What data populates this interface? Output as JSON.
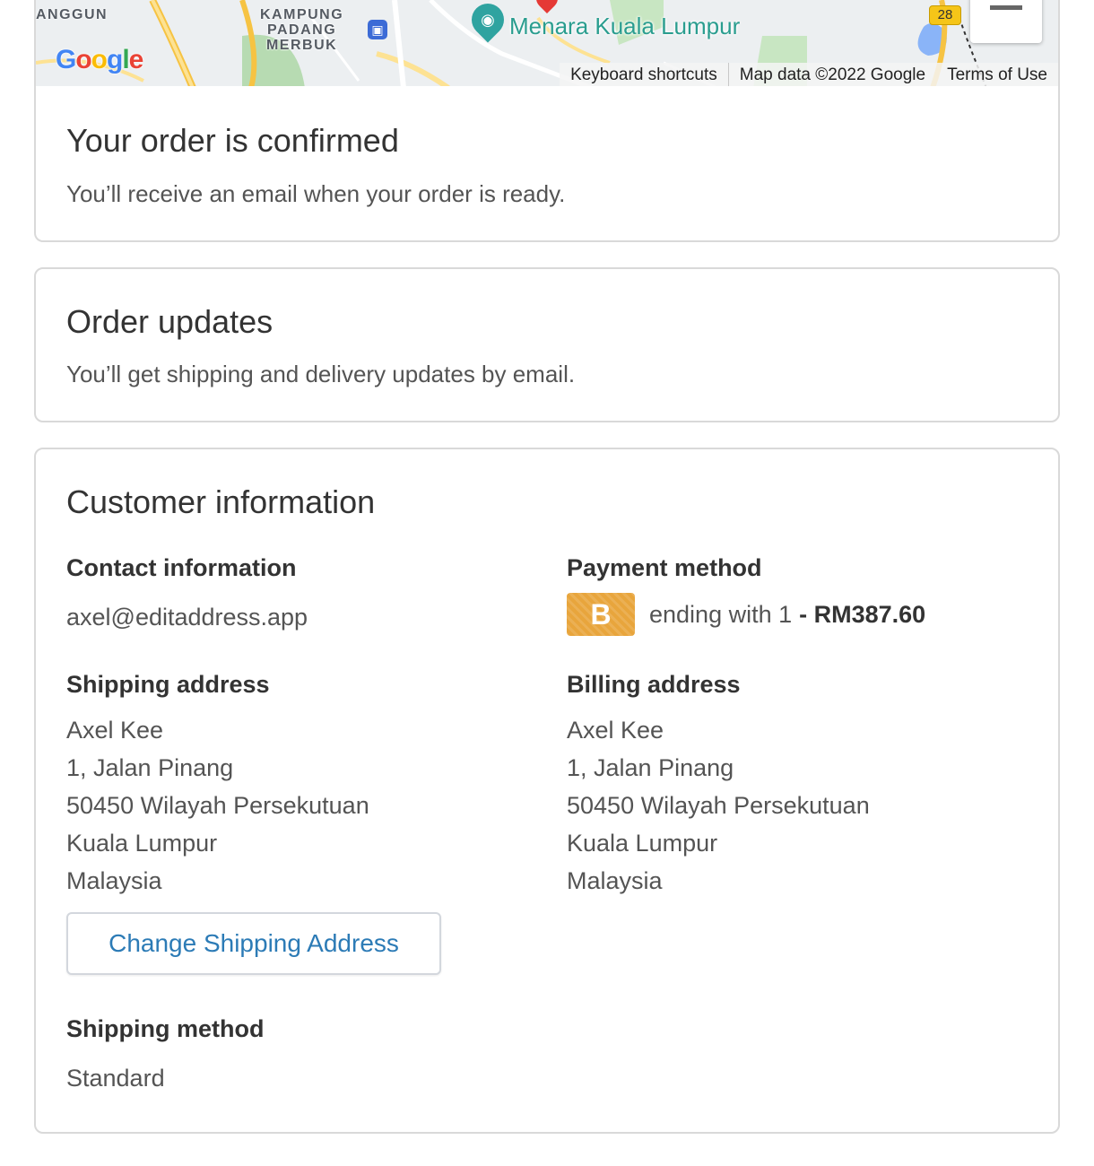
{
  "map": {
    "areas": [
      {
        "text": "ANGGUN"
      },
      {
        "text": "KAMPUNG\nPADANG\nMERBUK"
      }
    ],
    "landmark": "Menara Kuala Lumpur",
    "road_number": "28",
    "logo": "Google",
    "attribution": {
      "keyboard": "Keyboard shortcuts",
      "data": "Map data ©2022 Google",
      "terms": "Terms of Use"
    },
    "icons": {
      "zoom": "zoom-out-icon",
      "train": "train-station-icon",
      "landmark": "camera-pin-icon",
      "marker": "location-pin-icon"
    }
  },
  "confirmation": {
    "title": "Your order is confirmed",
    "subtitle": "You’ll receive an email when your order is ready."
  },
  "updates": {
    "title": "Order updates",
    "subtitle": "You’ll get shipping and delivery updates by email."
  },
  "customer": {
    "title": "Customer information",
    "contact": {
      "label": "Contact information",
      "email": "axel@editaddress.app"
    },
    "payment": {
      "label": "Payment method",
      "brand_letter": "B",
      "ending_text": "ending with 1",
      "amount": "- RM387.60",
      "brand_color": "#e8a53c"
    },
    "shipping_address": {
      "label": "Shipping address",
      "lines": [
        "Axel Kee",
        "1, Jalan Pinang",
        "50450 Wilayah Persekutuan",
        "Kuala Lumpur",
        "Malaysia"
      ]
    },
    "billing_address": {
      "label": "Billing address",
      "lines": [
        "Axel Kee",
        "1, Jalan Pinang",
        "50450 Wilayah Persekutuan",
        "Kuala Lumpur",
        "Malaysia"
      ]
    },
    "change_button": "Change Shipping Address",
    "shipping_method": {
      "label": "Shipping method",
      "value": "Standard"
    }
  },
  "colors": {
    "link": "#2c7bb6",
    "border": "#d9d9d9",
    "landmark": "#2a9d8f"
  }
}
